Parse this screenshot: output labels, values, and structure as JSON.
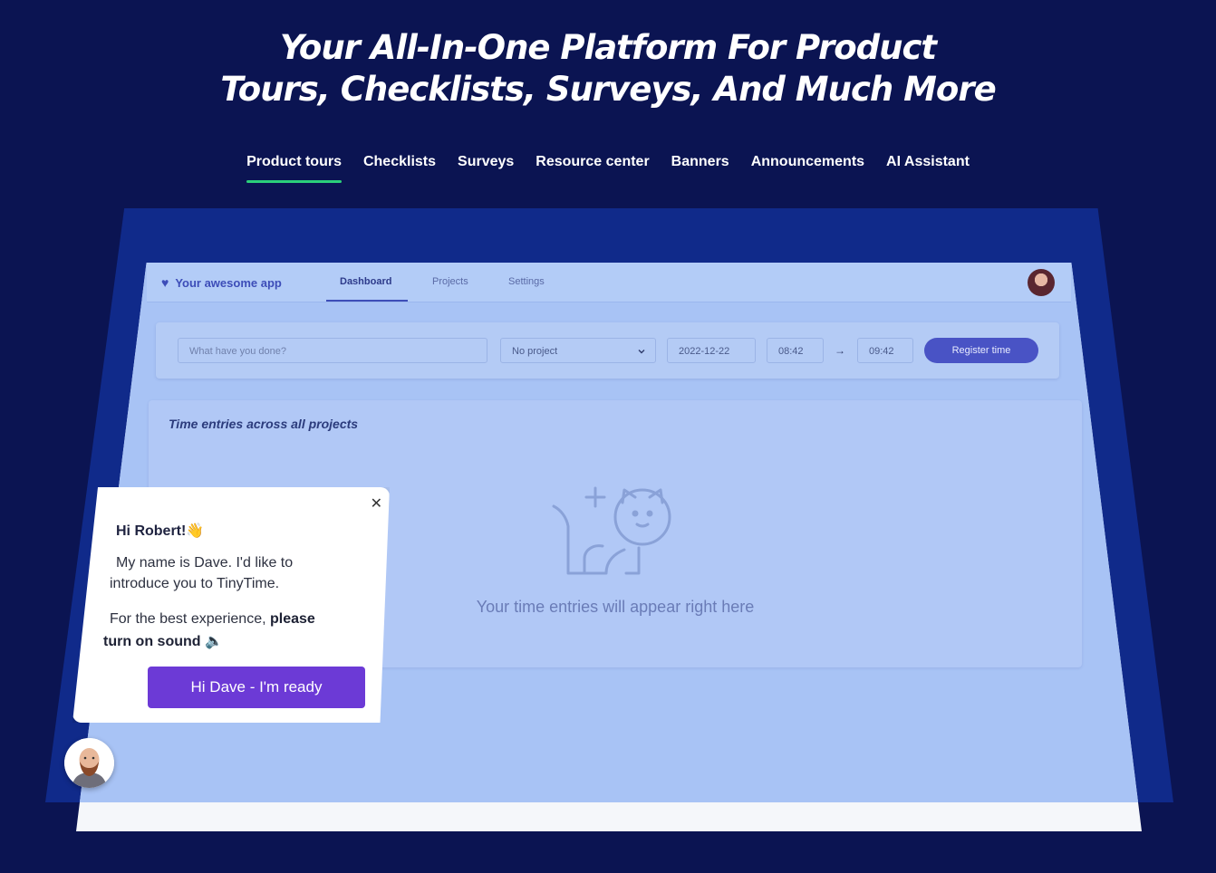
{
  "hero": {
    "title_line1": "Your All-In-One Platform For Product",
    "title_line2": "Tours, Checklists, Surveys, And Much More"
  },
  "tabs": [
    {
      "label": "Product tours",
      "active": true
    },
    {
      "label": "Checklists"
    },
    {
      "label": "Surveys"
    },
    {
      "label": "Resource center"
    },
    {
      "label": "Banners"
    },
    {
      "label": "Announcements"
    },
    {
      "label": "AI Assistant"
    }
  ],
  "app": {
    "brand": "Your awesome app",
    "nav": [
      "Dashboard",
      "Projects",
      "Settings"
    ],
    "active_nav": "Dashboard",
    "form": {
      "description_placeholder": "What have you done?",
      "project": "No project",
      "date": "2022-12-22",
      "start": "08:42",
      "end": "09:42",
      "submit": "Register time"
    },
    "entries_title": "Time entries across all projects",
    "empty_text": "Your time entries will appear right here"
  },
  "popup": {
    "greeting": "Hi Robert!👋",
    "line1a": "My name is Dave. I'd like to",
    "line1b": "introduce you to TinyTime.",
    "line2a": "For the best experience,",
    "line2a_bold": "please",
    "line2b_bold": "turn on sound",
    "line2b_icon": "🔈",
    "cta": "Hi Dave - I'm ready"
  },
  "colors": {
    "background": "#0b1452",
    "tab_underline": "#2bd07a",
    "primary_button": "#4953c5",
    "cta_button": "#6c3ad6"
  }
}
